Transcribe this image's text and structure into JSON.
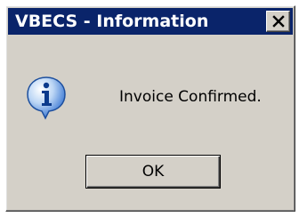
{
  "dialog": {
    "title": "VBECS - Information",
    "message": "Invoice Confirmed.",
    "ok_label": "OK",
    "icon": "information-icon",
    "close_icon": "close-icon"
  },
  "colors": {
    "titlebar": "#0a246a",
    "face": "#d4d0c8",
    "icon_blue": "#2f6fd0"
  }
}
